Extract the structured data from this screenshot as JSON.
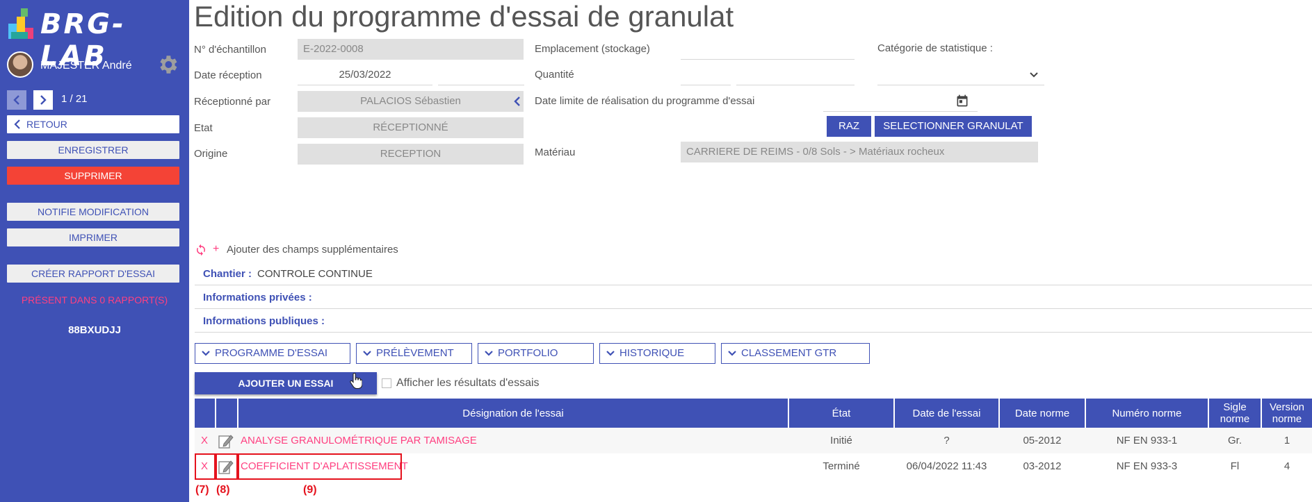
{
  "app": {
    "name": "BRG-LAB"
  },
  "user": {
    "name": "MAJESTER André"
  },
  "pager": {
    "text": "1 / 21"
  },
  "sidebar": {
    "back": "RETOUR",
    "save": "ENREGISTRER",
    "delete": "SUPPRIMER",
    "notify": "NOTIFIE MODIFICATION",
    "print": "IMPRIMER",
    "create_report": "CRÉER RAPPORT D'ESSAI",
    "present": "PRÉSENT DANS 0 RAPPORT(S)",
    "code": "88BXUDJJ"
  },
  "page": {
    "title": "Edition du programme d'essai de granulat"
  },
  "form": {
    "sample_label": "N° d'échantillon",
    "sample_value": "E-2022-0008",
    "reception_date_label": "Date réception",
    "reception_date_value": "25/03/2022",
    "received_by_label": "Réceptionné par",
    "received_by_value": "PALACIOS Sébastien",
    "state_label": "Etat",
    "state_value": "RÉCEPTIONNÉ",
    "origin_label": "Origine",
    "origin_value": "RECEPTION",
    "location_label": "Emplacement (stockage)",
    "quantity_label": "Quantité",
    "deadline_label": "Date limite de réalisation  du programme d'essai",
    "stat_category_label": "Catégorie de statistique :",
    "raz": "RAZ",
    "select_granulat": "SELECTIONNER GRANULAT",
    "material_label": "Matériau",
    "material_value": "CARRIERE DE REIMS - 0/8 Sols - > Matériaux rocheux"
  },
  "extra_fields": {
    "add_label": "Ajouter des champs supplémentaires"
  },
  "info": {
    "chantier_label": "Chantier :",
    "chantier_value": "CONTROLE CONTINUE",
    "private_label": "Informations privées :",
    "public_label": "Informations publiques :"
  },
  "tabs": [
    "PROGRAMME D'ESSAI",
    "PRÉLÈVEMENT",
    "PORTFOLIO",
    "HISTORIQUE",
    "CLASSEMENT GTR"
  ],
  "actions": {
    "add_test": "AJOUTER UN ESSAI",
    "show_results": "Afficher les résultats d'essais"
  },
  "table": {
    "headers": [
      "Désignation de l'essai",
      "État",
      "Date de l'essai",
      "Date norme",
      "Numéro norme",
      "Sigle norme",
      "Version norme"
    ],
    "rows": [
      {
        "x": "X",
        "designation": "ANALYSE GRANULOMÉTRIQUE PAR TAMISAGE",
        "state": "Initié",
        "date": "?",
        "norm_date": "05-2012",
        "norm_number": "NF EN 933-1",
        "sigle": "Gr.",
        "version": "1"
      },
      {
        "x": "X",
        "designation": "COEFFICIENT D'APLATISSEMENT",
        "state": "Terminé",
        "date": "06/04/2022 11:43",
        "norm_date": "03-2012",
        "norm_number": "NF EN 933-3",
        "sigle": "Fl",
        "version": "4"
      }
    ]
  },
  "annotations": [
    "(7)",
    "(8)",
    "(9)"
  ],
  "colors": {
    "primary": "#3f51b5",
    "danger": "#f44336",
    "accent": "#ff4081",
    "highlight": "#e5121d"
  }
}
